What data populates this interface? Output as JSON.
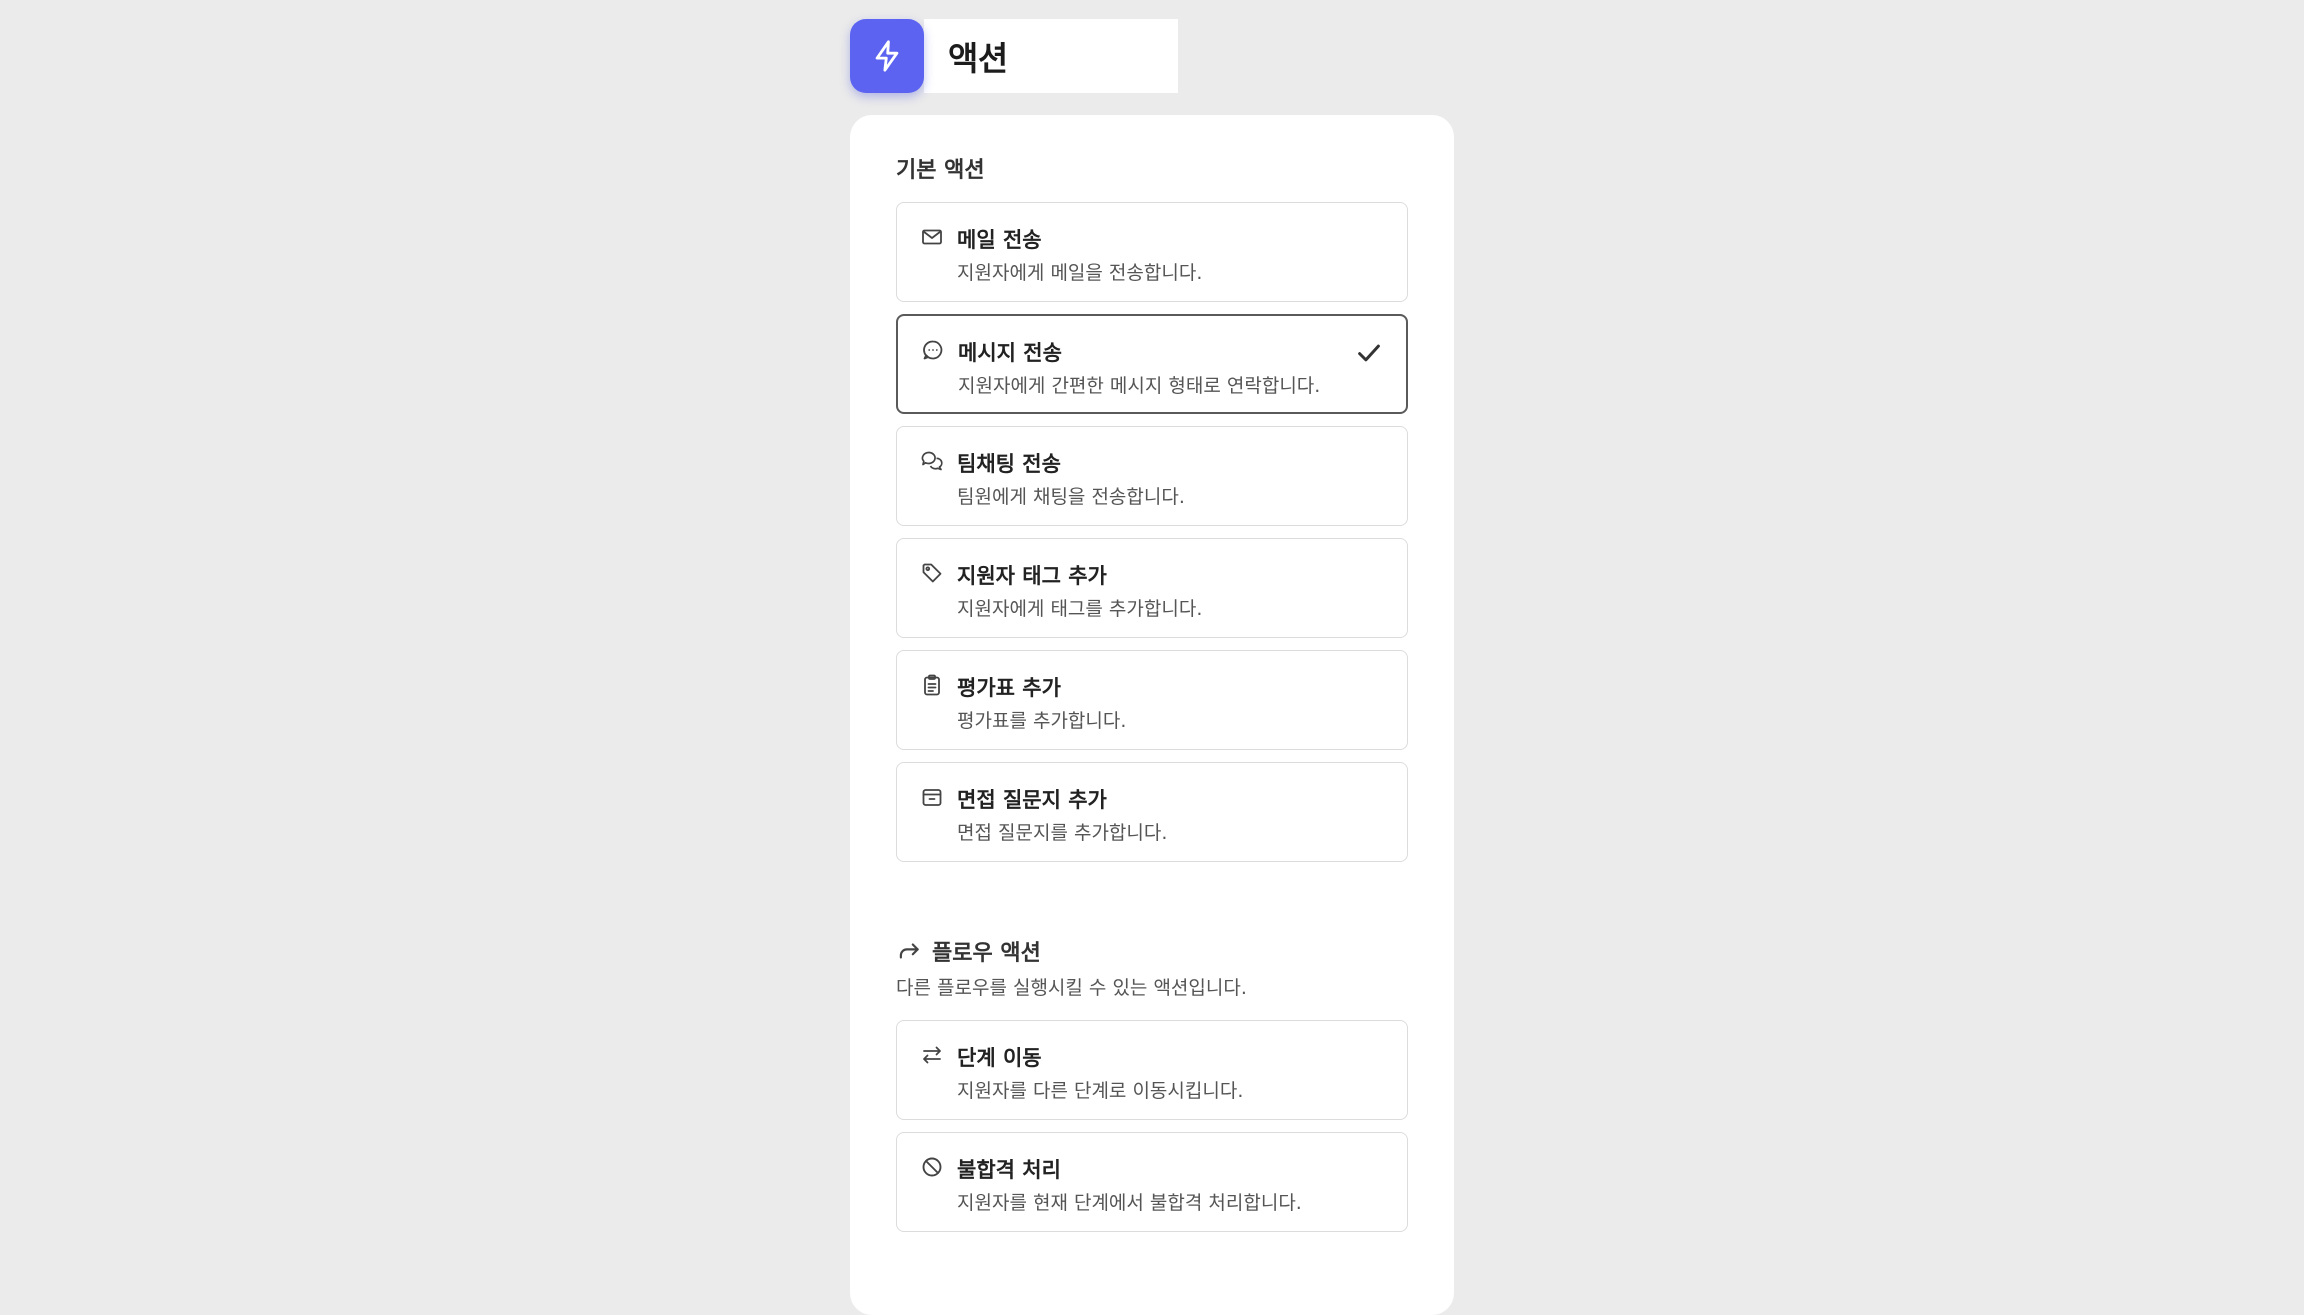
{
  "header": {
    "title": "액션",
    "icon": "lightning-bolt-icon",
    "accent_color": "#5b63f0"
  },
  "basic_section": {
    "title": "기본 액션",
    "items": [
      {
        "icon": "mail-icon",
        "title": "메일 전송",
        "desc": "지원자에게 메일을 전송합니다.",
        "selected": false
      },
      {
        "icon": "message-circle-icon",
        "title": "메시지 전송",
        "desc": "지원자에게 간편한 메시지 형태로 연락합니다.",
        "selected": true
      },
      {
        "icon": "chat-bubbles-icon",
        "title": "팀채팅 전송",
        "desc": "팀원에게 채팅을 전송합니다.",
        "selected": false
      },
      {
        "icon": "tag-icon",
        "title": "지원자 태그 추가",
        "desc": "지원자에게 태그를 추가합니다.",
        "selected": false
      },
      {
        "icon": "clipboard-icon",
        "title": "평가표 추가",
        "desc": "평가표를 추가합니다.",
        "selected": false
      },
      {
        "icon": "archive-box-icon",
        "title": "면접 질문지 추가",
        "desc": "면접 질문지를 추가합니다.",
        "selected": false
      }
    ]
  },
  "flow_section": {
    "icon": "redirect-arrow-icon",
    "title": "플로우 액션",
    "desc": "다른 플로우를 실행시킬 수 있는 액션입니다.",
    "items": [
      {
        "icon": "swap-arrows-icon",
        "title": "단계 이동",
        "desc": "지원자를 다른 단계로 이동시킵니다.",
        "selected": false
      },
      {
        "icon": "ban-icon",
        "title": "불합격 처리",
        "desc": "지원자를 현재 단계에서 불합격 처리합니다.",
        "selected": false
      }
    ]
  }
}
